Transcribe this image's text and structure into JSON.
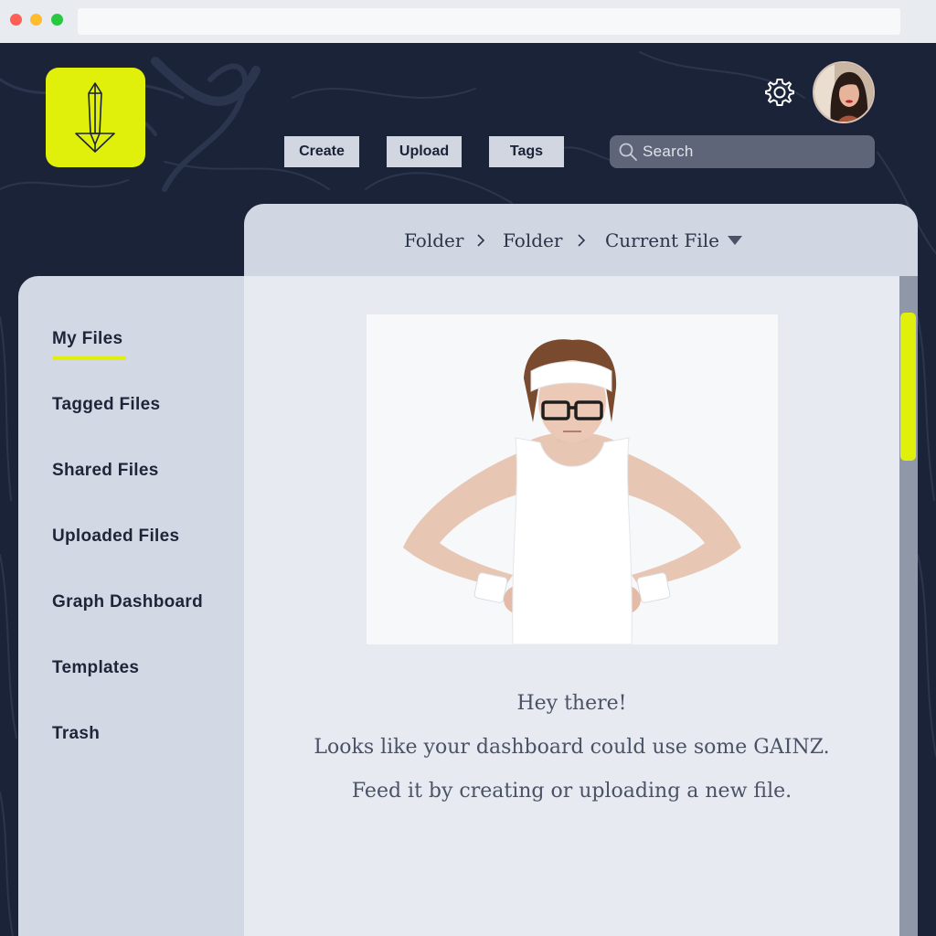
{
  "toolbar": {
    "create_label": "Create",
    "upload_label": "Upload",
    "tags_label": "Tags"
  },
  "search": {
    "placeholder": "Search"
  },
  "breadcrumb": {
    "items": [
      "Folder",
      "Folder",
      "Current File"
    ]
  },
  "sidebar": {
    "items": [
      {
        "label": "My Files",
        "active": true
      },
      {
        "label": "Tagged Files"
      },
      {
        "label": "Shared Files"
      },
      {
        "label": "Uploaded Files"
      },
      {
        "label": "Graph Dashboard"
      },
      {
        "label": "Templates"
      },
      {
        "label": "Trash"
      }
    ]
  },
  "empty_state": {
    "line1": "Hey there!",
    "line2": "Looks like your dashboard could use some GAINZ.",
    "line3": "Feed it by creating or uploading a new file."
  },
  "icons": {
    "logo": "sword-icon",
    "settings": "gear-icon",
    "search": "search-icon",
    "separator": "chevron-right-icon",
    "dropdown": "caret-down-icon"
  },
  "colors": {
    "accent": "#e0f00a",
    "background": "#1b2339",
    "sidebar": "#d3d9e4",
    "content": "#e7eaf0"
  }
}
